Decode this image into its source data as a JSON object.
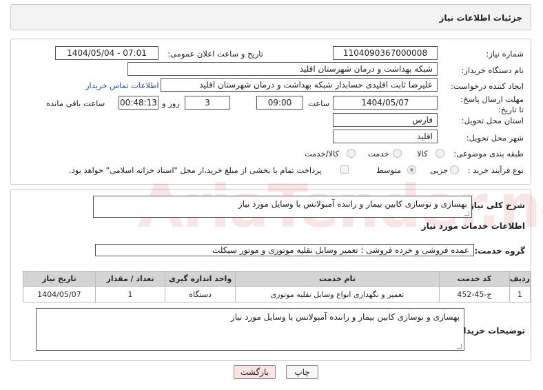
{
  "header": {
    "title": "جزئیات اطلاعات نیاز"
  },
  "form": {
    "need_number": {
      "label": "شماره نیاز:",
      "value": "1104090367000008"
    },
    "announce_datetime": {
      "label": "تاریخ و ساعت اعلان عمومی:",
      "value": "1404/05/04 - 07:01"
    },
    "buyer_org": {
      "label": "نام دستگاه خریدار:",
      "value": "شبکه بهداشت و درمان شهرستان اقلید"
    },
    "requester": {
      "label": "ایجاد کننده درخواست:",
      "value": "علیرضا ثابت اقلیدی حسابدار شبکه بهداشت و درمان شهرستان اقلید",
      "contact_link": "اطلاعات تماس خریدار"
    },
    "deadline": {
      "label": "مهلت ارسال پاسخ: تا تاریخ:",
      "date": "1404/05/07",
      "time_label": "ساعت",
      "time": "09:00",
      "days": "3",
      "days_label": "روز و",
      "remaining": "00:48:13",
      "remaining_label": "ساعت باقی مانده"
    },
    "province": {
      "label": "استان محل تحویل:",
      "value": "فارس"
    },
    "city": {
      "label": "شهر محل تحویل:",
      "value": "اقلید"
    },
    "category": {
      "label": "طبقه بندی موضوعی:",
      "options": [
        "کالا",
        "خدمت",
        "کالا/خدمت"
      ]
    },
    "process": {
      "label": "نوع فرآیند خرید :",
      "options": [
        "جزیی",
        "متوسط"
      ],
      "note": "پرداخت تمام یا بخشی از مبلغ خرید،از محل \"اسناد خزانه اسلامی\" خواهد بود."
    }
  },
  "general": {
    "label": "شرح کلی نیاز:",
    "value": "بهسازی و نوسازی کابین بیمار و راننده آمبولانس با وسایل مورد نیاز"
  },
  "services": {
    "section_title": "اطلاعات خدمات مورد نیاز",
    "group_label": "گروه خدمت:",
    "group_value": "عمده فروشی و خرده فروشی ؛ تعمیر وسایل نقلیه موتوری و موتور سیکلت",
    "table": {
      "headers": [
        "ردیف",
        "کد خدمت",
        "نام خدمت",
        "واحد اندازه گیری",
        "تعداد / مقدار",
        "تاریخ نیاز"
      ],
      "rows": [
        [
          "1",
          "ج-45-452",
          "تعمیر و نگهداری انواع وسایل نقلیه موتوری",
          "دستگاه",
          "1",
          "1404/05/07"
        ]
      ]
    }
  },
  "buyer_notes": {
    "label": "توضیحات خریدار:",
    "value": "بهسازی و نوسازی کابین بیمار و راننده آمبولانس با وسایل مورد نیاز"
  },
  "buttons": {
    "print": "چاپ",
    "back": "بازگشت"
  },
  "watermark": {
    "text": "AriaTender.net"
  },
  "colors": {
    "header_bg": "#f3f3f3",
    "table_header_bg": "#d4d4d4",
    "link": "#1f4fb5",
    "back_button_bg": "#fde3e3",
    "watermark": "#c83c3c"
  }
}
